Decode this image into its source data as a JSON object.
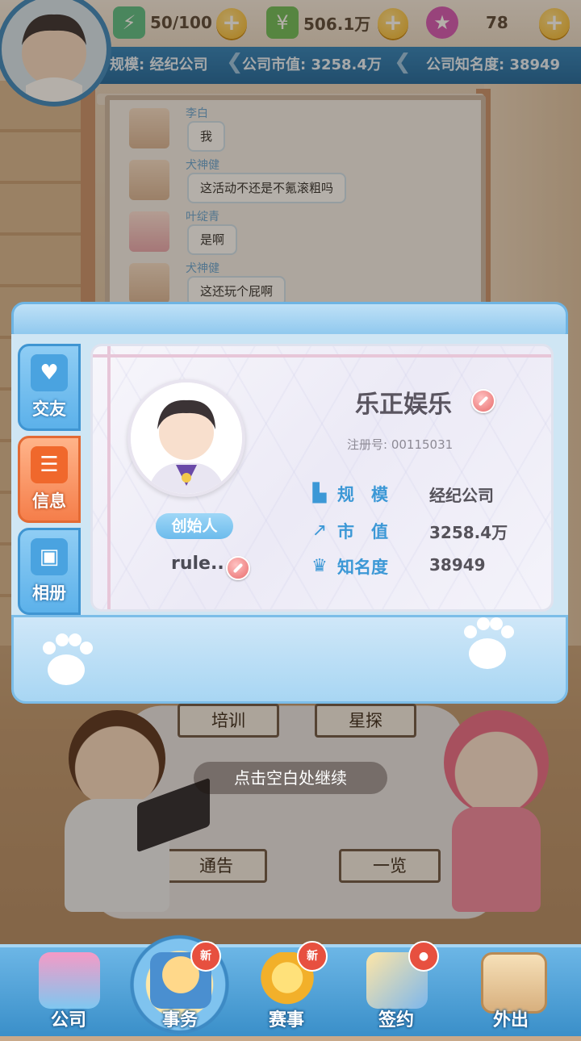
{
  "resources": {
    "energy": "50/100",
    "money": "506.1万",
    "gems": "78"
  },
  "company_bar": {
    "scale": "规模: 经纪公司",
    "market_value": "公司市值: 3258.4万",
    "fame": "公司知名度: 38949"
  },
  "chat": [
    {
      "name": "李白",
      "message": "我"
    },
    {
      "name": "犬神健",
      "message": "这活动不还是不氪滚粗吗"
    },
    {
      "name": "叶绽青",
      "message": "是啊"
    },
    {
      "name": "犬神健",
      "message": "这还玩个屁啊"
    }
  ],
  "popup": {
    "tabs": [
      {
        "label": "交友",
        "icon": "heart-chat-icon"
      },
      {
        "label": "信息",
        "icon": "info-list-icon"
      },
      {
        "label": "相册",
        "icon": "photo-icon"
      }
    ],
    "company_name": "乐正娱乐",
    "reg_number": "注册号: 00115031",
    "founder_badge": "创始人",
    "owner_name": "rule..",
    "stats": [
      {
        "label": "规　模",
        "value": "经纪公司",
        "icon": "building-icon"
      },
      {
        "label": "市　值",
        "value": "3258.4万",
        "icon": "trend-up-icon"
      },
      {
        "label": "知名度",
        "value": "38949",
        "icon": "crown-icon"
      }
    ]
  },
  "scene": {
    "plate_train": "培训",
    "plate_scout": "星探",
    "plate_notice": "通告",
    "plate_overview": "一览"
  },
  "continue_hint": "点击空白处继续",
  "nav": [
    {
      "label": "公司",
      "badge": ""
    },
    {
      "label": "事务",
      "badge": "新"
    },
    {
      "label": "赛事",
      "badge": "新"
    },
    {
      "label": "签约",
      "badge": ""
    },
    {
      "label": "外出",
      "badge": ""
    }
  ],
  "colors": {
    "accent_blue": "#3c98d6",
    "popup_frame": "#8fc8ee",
    "tab_active": "#f57e4a",
    "badge_red": "#e7503f"
  }
}
